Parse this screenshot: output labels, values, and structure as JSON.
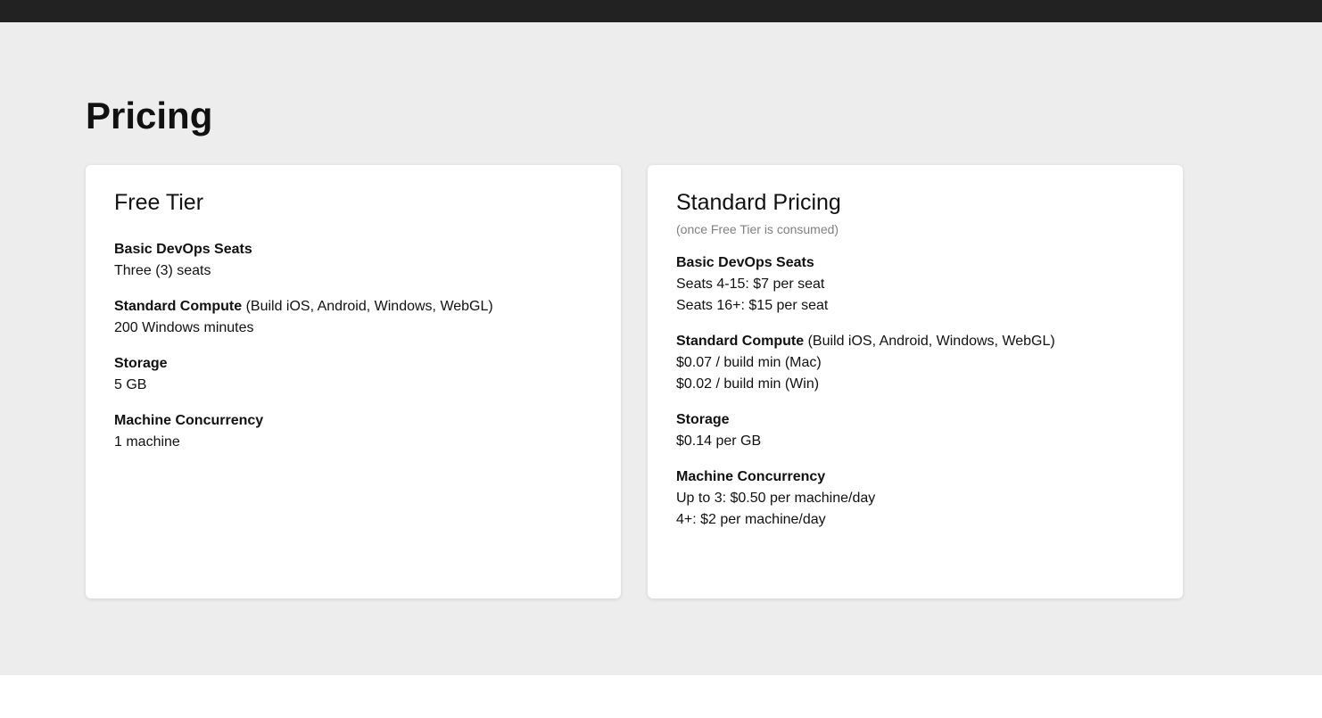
{
  "page": {
    "title": "Pricing"
  },
  "free_tier": {
    "title": "Free Tier",
    "groups": [
      {
        "label": "Basic DevOps Seats",
        "suffix": "",
        "lines": [
          "Three (3) seats"
        ]
      },
      {
        "label": "Standard Compute",
        "suffix": " (Build iOS, Android, Windows, WebGL)",
        "lines": [
          "200 Windows minutes"
        ]
      },
      {
        "label": "Storage",
        "suffix": "",
        "lines": [
          "5 GB"
        ]
      },
      {
        "label": "Machine Concurrency",
        "suffix": "",
        "lines": [
          "1 machine"
        ]
      }
    ]
  },
  "standard_pricing": {
    "title": "Standard Pricing",
    "subtitle": "(once Free Tier is consumed)",
    "groups": [
      {
        "label": "Basic DevOps Seats",
        "suffix": "",
        "lines": [
          "Seats 4-15: $7 per seat",
          "Seats 16+: $15 per seat"
        ]
      },
      {
        "label": "Standard Compute",
        "suffix": " (Build iOS, Android, Windows, WebGL)",
        "lines": [
          "$0.07 / build min (Mac)",
          "$0.02 / build min (Win)"
        ]
      },
      {
        "label": "Storage",
        "suffix": "",
        "lines": [
          "$0.14 per GB"
        ]
      },
      {
        "label": "Machine Concurrency",
        "suffix": "",
        "lines": [
          "Up to 3: $0.50 per machine/day",
          "4+: $2 per machine/day"
        ]
      }
    ]
  }
}
